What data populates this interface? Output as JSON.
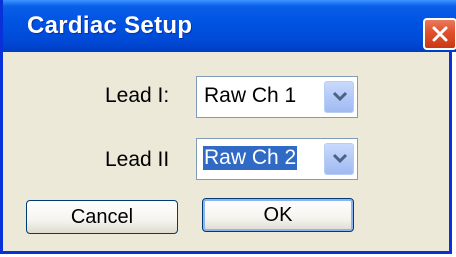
{
  "window": {
    "title": "Cardiac Setup"
  },
  "fields": {
    "lead1": {
      "label": "Lead I:",
      "value": "Raw Ch 1"
    },
    "lead2": {
      "label": "Lead II",
      "value": "Raw Ch 2"
    }
  },
  "buttons": {
    "cancel": "Cancel",
    "ok": "OK"
  },
  "icons": {
    "close": "close-icon",
    "dropdown": "chevron-down-icon"
  },
  "colors": {
    "titlebar": "#0054e3",
    "close_button": "#e0502a",
    "dialog_background": "#ece9d8",
    "selection": "#316ac5"
  }
}
